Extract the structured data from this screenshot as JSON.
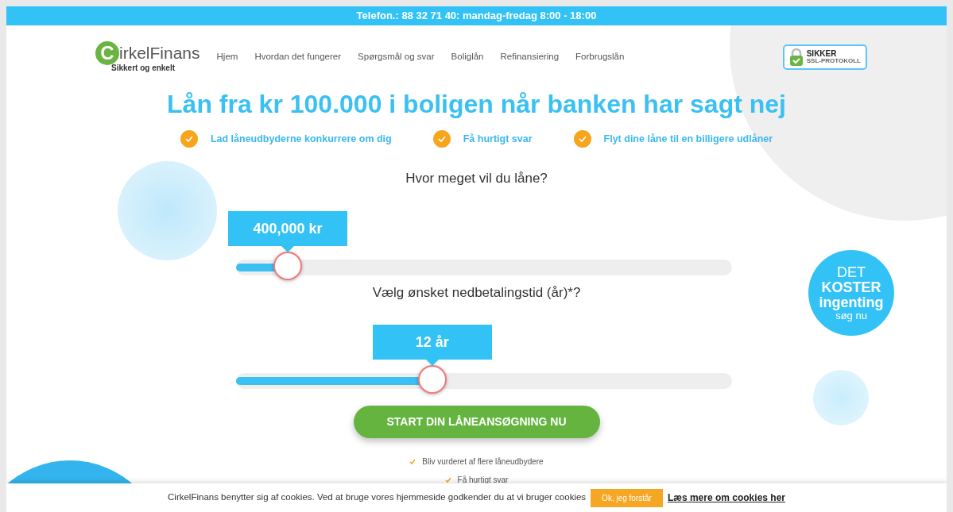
{
  "top_bar": {
    "text": "Telefon.: 88 32 71 40: mandag-fredag 8:00 - 18:00"
  },
  "logo": {
    "letter": "C",
    "name": "irkelFinans",
    "tagline": "Sikkert og enkelt"
  },
  "nav": [
    {
      "label": "Hjem"
    },
    {
      "label": "Hvordan det fungerer"
    },
    {
      "label": "Spørgsmål og svar"
    },
    {
      "label": "Boliglån"
    },
    {
      "label": "Refinansiering"
    },
    {
      "label": "Forbrugslån"
    }
  ],
  "ssl_badge": {
    "line1": "SIKKER",
    "line2": "SSL-PROTOKOLL"
  },
  "headline": "Lån fra kr 100.000 i boligen når banken har sagt nej",
  "benefits": [
    {
      "text": "Lad låneudbyderne konkurrere om dig"
    },
    {
      "text": "Få hurtigt svar"
    },
    {
      "text": "Flyt dine låne til en billigere udlåner"
    }
  ],
  "sliders": [
    {
      "question": "Hvor meget vil du låne?",
      "value": "400,000 kr",
      "level": 0.08
    },
    {
      "question": "Vælg ønsket nedbetalingstid (år)*?",
      "value": "12 år",
      "level": 0.39
    }
  ],
  "promo": {
    "line1": "DET",
    "line2": "KOSTER",
    "line3": "ingenting",
    "line4": "søg nu"
  },
  "cta_button": "START DIN LÅNEANSØGNING NU",
  "checks": [
    {
      "text": "Bliv vurderet af flere låneudbydere"
    },
    {
      "text": "Få hurtigt svar"
    }
  ],
  "cookie_bar": {
    "text": "CirkelFinans benytter sig af cookies. Ved at bruge vores hjemmeside godkender du at vi bruger cookies",
    "accept": "Ok, jeg forstår",
    "link": "Læs mere om cookies her"
  }
}
